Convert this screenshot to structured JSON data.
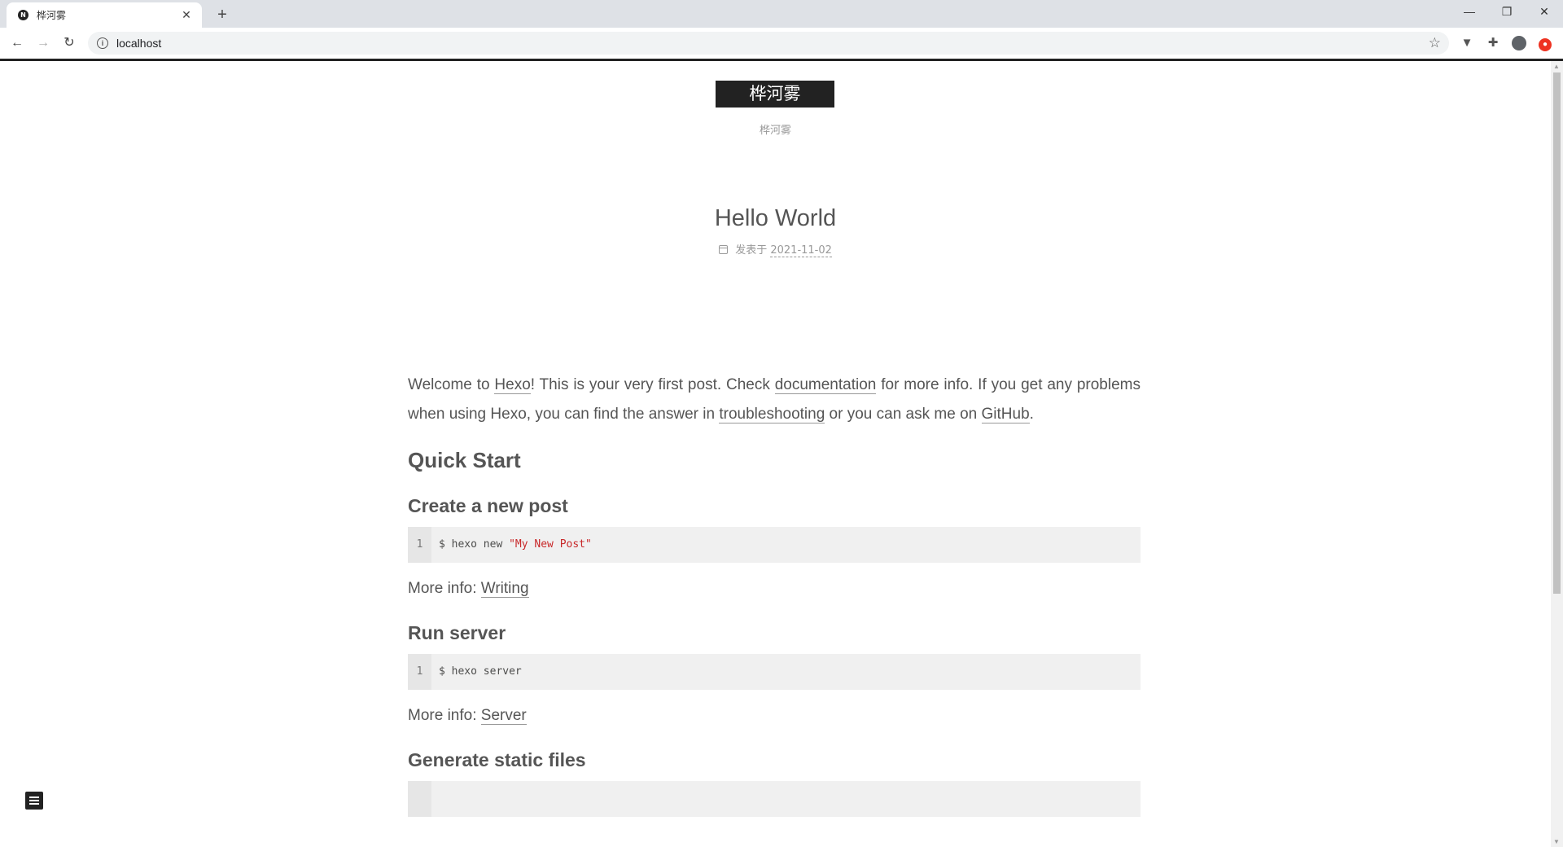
{
  "browser": {
    "tab_title": "桦河雾",
    "tab_favicon": "N",
    "close_glyph": "✕",
    "new_tab_glyph": "+",
    "url": "localhost",
    "win_min": "—",
    "win_restore": "❐",
    "win_close": "✕",
    "back_glyph": "←",
    "forward_glyph": "→",
    "reload_glyph": "↻",
    "star_glyph": "☆",
    "info_glyph": "i",
    "ext1_glyph": "▼",
    "ext2_glyph": "✚"
  },
  "site": {
    "brand": "桦河雾",
    "subtitle": "桦河雾"
  },
  "post": {
    "title": "Hello World",
    "meta_label": "发表于",
    "date": "2021-11-02",
    "intro": {
      "t1": "Welcome to ",
      "link_hexo": "Hexo",
      "t2": "! This is your very first post. Check ",
      "link_docs": "documentation",
      "t3": " for more info. If you get any problems when using Hexo, you can find the answer in ",
      "link_trouble": "troubleshooting",
      "t4": " or you can ask me on ",
      "link_github": "GitHub",
      "t5": "."
    },
    "quick_start": "Quick Start",
    "sections": [
      {
        "heading": "Create a new post",
        "line_no": "1",
        "code_prefix": "$ hexo new ",
        "code_string": "\"My New Post\"",
        "more_label": "More info: ",
        "more_link": "Writing"
      },
      {
        "heading": "Run server",
        "line_no": "1",
        "code_prefix": "$ hexo server",
        "code_string": "",
        "more_label": "More info: ",
        "more_link": "Server"
      },
      {
        "heading": "Generate static files"
      }
    ]
  },
  "colors": {
    "brand_bg": "#222222",
    "text": "#555555",
    "code_bg": "#f0f0f0",
    "code_string": "#c82829"
  }
}
